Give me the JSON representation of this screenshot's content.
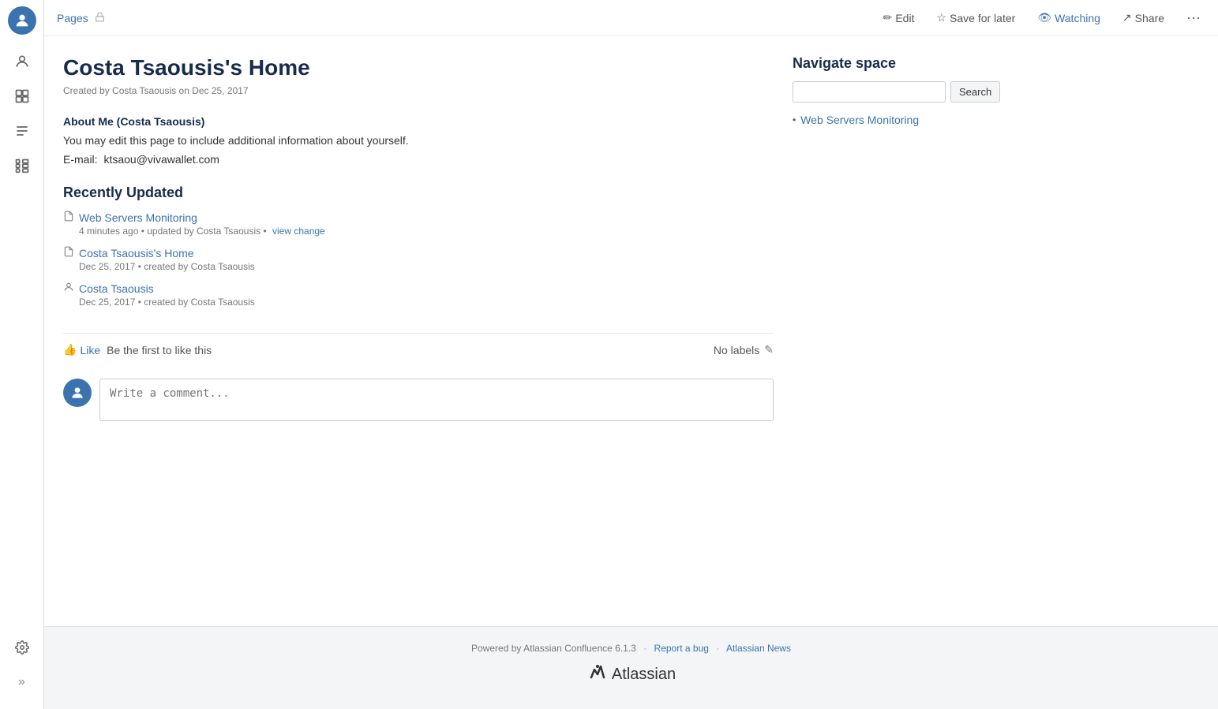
{
  "sidebar": {
    "items": [
      {
        "name": "home-icon",
        "label": "Home",
        "icon": "⌂"
      },
      {
        "name": "people-icon",
        "label": "People",
        "icon": "👤"
      },
      {
        "name": "spaces-icon",
        "label": "Spaces",
        "icon": "⊞"
      },
      {
        "name": "feed-icon",
        "label": "Feed",
        "icon": "◉"
      },
      {
        "name": "tree-icon",
        "label": "Tree",
        "icon": "⊟"
      }
    ],
    "bottom": [
      {
        "name": "settings-icon",
        "label": "Settings",
        "icon": "⚙"
      },
      {
        "name": "expand-icon",
        "label": "Expand",
        "icon": "»"
      }
    ]
  },
  "topbar": {
    "breadcrumb": "Pages",
    "lock_icon": "🔒",
    "actions": {
      "edit": "Edit",
      "save_for_later": "Save for later",
      "watching": "Watching",
      "share": "Share"
    }
  },
  "page": {
    "title": "Costa Tsaousis's Home",
    "meta": "Created by Costa Tsaousis on Dec 25, 2017",
    "about_heading": "About Me (Costa Tsaousis)",
    "about_text": "You may edit this page to include additional information about yourself.",
    "email_label": "E-mail:",
    "email_value": "ktsaou@vivawallet.com",
    "recently_updated": {
      "heading": "Recently Updated",
      "items": [
        {
          "type": "doc",
          "link_text": "Web Servers Monitoring",
          "meta": "4 minutes ago • updated by Costa Tsaousis •",
          "view_change": "view change"
        },
        {
          "type": "doc",
          "link_text": "Costa Tsaousis's Home",
          "meta": "Dec 25, 2017 • created by Costa Tsaousis"
        },
        {
          "type": "person",
          "link_text": "Costa Tsaousis",
          "meta": "Dec 25, 2017 • created by Costa Tsaousis"
        }
      ]
    }
  },
  "like_bar": {
    "like_label": "Like",
    "first_to_like": "Be the first to like this",
    "no_labels": "No labels",
    "edit_icon": "✎"
  },
  "comment": {
    "placeholder": "Write a comment..."
  },
  "navigate_space": {
    "title": "Navigate space",
    "search_placeholder": "",
    "search_button": "Search",
    "tree_items": [
      {
        "label": "Web Servers Monitoring"
      }
    ]
  },
  "footer": {
    "powered_by": "Powered by Atlassian Confluence 6.1.3",
    "separator1": "·",
    "report_bug": "Report a bug",
    "separator2": "·",
    "atlassian_news": "Atlassian News",
    "brand": "Atlassian"
  }
}
